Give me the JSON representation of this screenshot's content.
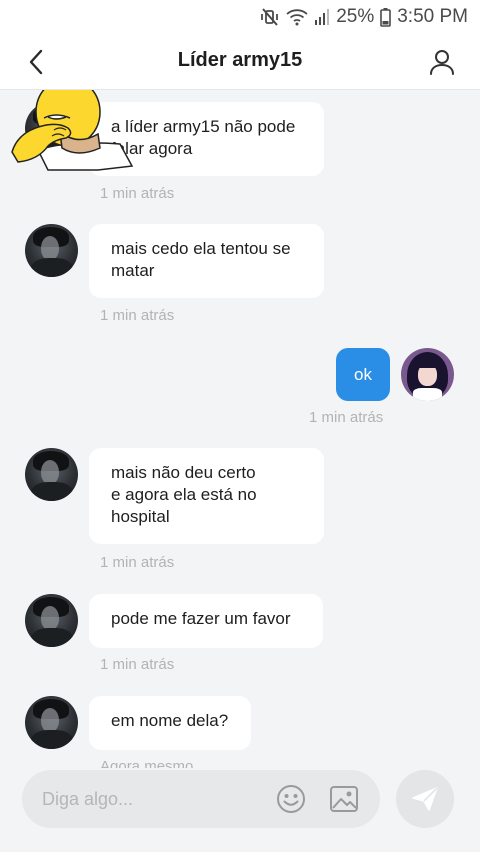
{
  "status_bar": {
    "battery_percent": "25%",
    "time": "3:50 PM",
    "icons": [
      "mute-vibrate-icon",
      "wifi-icon",
      "signal-icon",
      "battery-icon"
    ]
  },
  "header": {
    "title": "Líder army15",
    "back_icon": "chevron-left-icon",
    "profile_icon": "user-icon"
  },
  "messages": [
    {
      "side": "left",
      "text": "a líder army15 não pode\nfalar agora",
      "time": "1 min atrás",
      "sticker": "homer-facepalm"
    },
    {
      "side": "left",
      "text": "mais cedo ela tentou se\nmatar",
      "time": "1 min atrás"
    },
    {
      "side": "right",
      "text": "ok",
      "time": "1 min atrás"
    },
    {
      "side": "left",
      "text": "mais não deu certo\ne agora ela está no\nhospital",
      "time": "1 min atrás"
    },
    {
      "side": "left",
      "text": "pode me fazer um favor",
      "time": "1 min atrás"
    },
    {
      "side": "left",
      "text": "em nome dela?",
      "time": "Agora mesmo"
    }
  ],
  "composer": {
    "placeholder": "Diga algo...",
    "emoji_icon": "smiley-icon",
    "image_icon": "image-icon",
    "send_icon": "paper-plane-icon"
  },
  "colors": {
    "accent": "#2b8ee6",
    "background": "#f3f4f6",
    "bubble_in": "#ffffff",
    "timestamp": "#b3b3b3"
  }
}
